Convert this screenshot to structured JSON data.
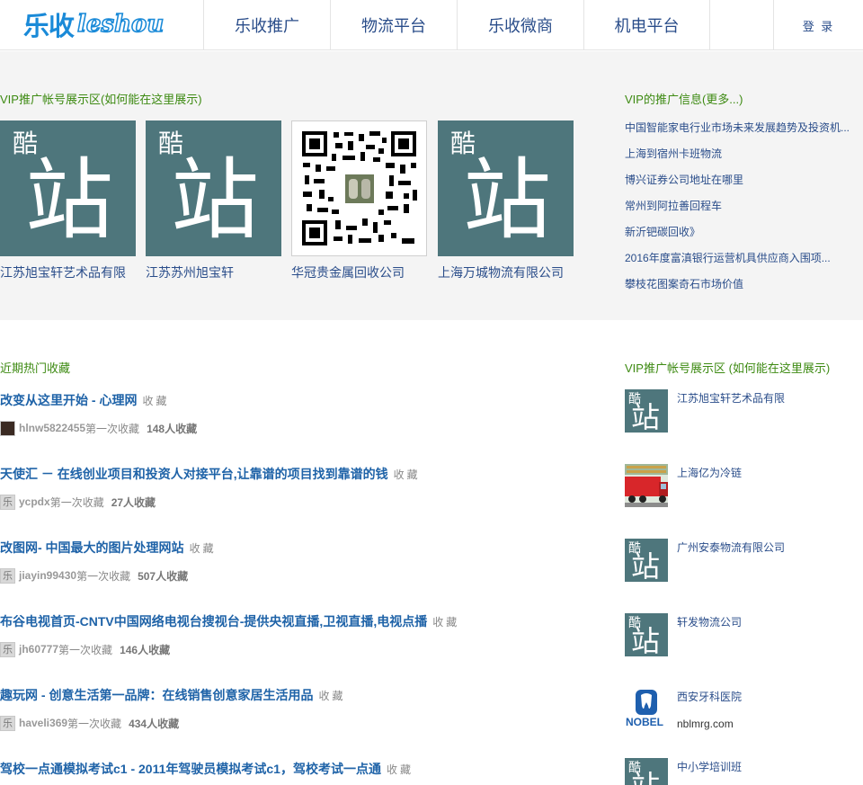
{
  "header": {
    "logo_cn": "乐收",
    "logo_en": "leshou",
    "nav": [
      "乐收推广",
      "物流平台",
      "乐收微商",
      "机电平台"
    ],
    "login": "登 录"
  },
  "vip": {
    "title": "VIP推广帐号展示区(如何能在这里展示)",
    "cards": [
      {
        "name": "江苏旭宝轩艺术品有限",
        "small": "酷",
        "big": "站"
      },
      {
        "name": "江苏苏州旭宝轩",
        "small": "酷",
        "big": "站"
      },
      {
        "name": "华冠贵金属回收公司",
        "small": "",
        "big": ""
      },
      {
        "name": "上海万城物流有限公司",
        "small": "酷",
        "big": "站"
      }
    ],
    "info_title": "VIP的推广信息(更多...)",
    "info_items": [
      "中国智能家电行业市场未来发展趋势及投资机...",
      "上海到宿州卡班物流",
      "博兴证券公司地址在哪里",
      "常州到阿拉善回程车",
      "新沂钯碳回收》",
      "2016年度富滇银行运营机具供应商入围项...",
      "攀枝花图案奇石市场价值"
    ]
  },
  "hot": {
    "title": "近期热门收藏",
    "fav_label": "收藏",
    "first_label": "第一次收藏",
    "items": [
      {
        "title": "改变从这里开始 - 心理网",
        "user": "hlnw5822455",
        "count": "148人收藏",
        "avatar": "photo"
      },
      {
        "title": "天使汇 － 在线创业项目和投资人对接平台,让靠谱的项目找到靠谱的钱",
        "user": "ycpdx",
        "count": "27人收藏",
        "avatar": "乐"
      },
      {
        "title": "改图网- 中国最大的图片处理网站",
        "user": "jiayin99430",
        "count": "507人收藏",
        "avatar": "乐"
      },
      {
        "title": "布谷电视首页-CNTV中国网络电视台搜视台-提供央视直播,卫视直播,电视点播",
        "user": "jh60777",
        "count": "146人收藏",
        "avatar": "乐"
      },
      {
        "title": "趣玩网 - 创意生活第一品牌：在线销售创意家居生活用品",
        "user": "haveli369",
        "count": "434人收藏",
        "avatar": "乐"
      },
      {
        "title": "驾校一点通模拟考试c1 - 2011年驾驶员模拟考试c1，驾校考试一点通",
        "user": "",
        "count": "",
        "avatar": ""
      }
    ]
  },
  "accounts": {
    "title": "VIP推广帐号展示区 (如何能在这里展示)",
    "items": [
      {
        "name": "江苏旭宝轩艺术品有限",
        "type": "kuzhan",
        "sub": ""
      },
      {
        "name": "上海亿为冷链",
        "type": "truck",
        "sub": ""
      },
      {
        "name": "广州安泰物流有限公司",
        "type": "kuzhan",
        "sub": ""
      },
      {
        "name": "轩发物流公司",
        "type": "kuzhan",
        "sub": ""
      },
      {
        "name": "西安牙科医院",
        "type": "nobel",
        "sub": "nblmrg.com"
      },
      {
        "name": "中小学培训班",
        "type": "kuzhan",
        "sub": ""
      }
    ],
    "kuzhan_small": "酷",
    "kuzhan_big": "站",
    "nobel_text": "NOBEL"
  },
  "colors": {
    "brand": "#1a8ad8",
    "link": "#1f63a8",
    "green_title": "#3d8a12",
    "tile": "#4e767c"
  }
}
